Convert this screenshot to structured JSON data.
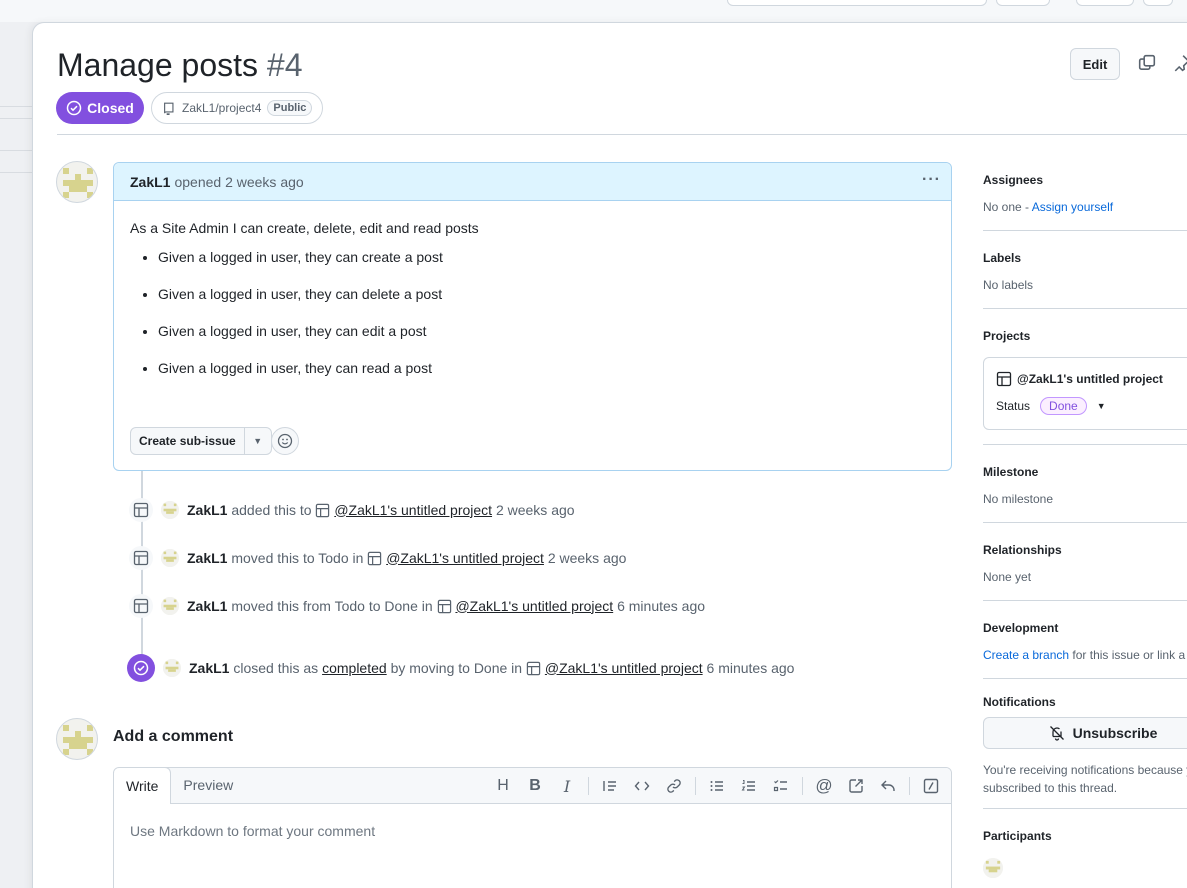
{
  "issue": {
    "title": "Manage posts",
    "number": "#4",
    "state": "Closed",
    "repo": "ZakL1/project4",
    "visibility": "Public",
    "edit_label": "Edit"
  },
  "comment": {
    "author": "ZakL1",
    "meta": "opened 2 weeks ago",
    "intro": "As a Site Admin I can create, delete, edit and read posts",
    "items": [
      "Given a logged in user, they can create a post",
      "Given a logged in user, they can delete a post",
      "Given a logged in user, they can edit a post",
      "Given a logged in user, they can read a post"
    ],
    "sub_issue_label": "Create sub-issue"
  },
  "timeline": [
    {
      "actor": "ZakL1",
      "pre": "added this to",
      "project": "@ZakL1's untitled project",
      "time": "2 weeks ago"
    },
    {
      "actor": "ZakL1",
      "pre": "moved this to Todo in",
      "project": "@ZakL1's untitled project",
      "time": "2 weeks ago"
    },
    {
      "actor": "ZakL1",
      "pre": "moved this from Todo to Done in",
      "project": "@ZakL1's untitled project",
      "time": "6 minutes ago"
    },
    {
      "actor": "ZakL1",
      "pre": "closed this as",
      "link": "completed",
      "mid": "by moving to Done in",
      "project": "@ZakL1's untitled project",
      "time": "6 minutes ago"
    }
  ],
  "add_comment": {
    "heading": "Add a comment",
    "tab_write": "Write",
    "tab_preview": "Preview",
    "placeholder": "Use Markdown to format your comment"
  },
  "sidebar": {
    "assignees": {
      "heading": "Assignees",
      "value": "No one -",
      "link": "Assign yourself"
    },
    "labels": {
      "heading": "Labels",
      "value": "No labels"
    },
    "projects": {
      "heading": "Projects",
      "project_name": "@ZakL1's untitled project",
      "status_label": "Status",
      "status_value": "Done"
    },
    "milestone": {
      "heading": "Milestone",
      "value": "No milestone"
    },
    "relationships": {
      "heading": "Relationships",
      "value": "None yet"
    },
    "development": {
      "heading": "Development",
      "link": "Create a branch",
      "rest": "for this issue or link a p"
    },
    "notifications": {
      "heading": "Notifications",
      "button": "Unsubscribe",
      "note_line1": "You're receiving notifications because y",
      "note_line2": "subscribed to this thread."
    },
    "participants": {
      "heading": "Participants"
    }
  },
  "colors": {
    "closed": "#8250df",
    "link": "#0969da",
    "comment_header": "#ddf4ff"
  }
}
